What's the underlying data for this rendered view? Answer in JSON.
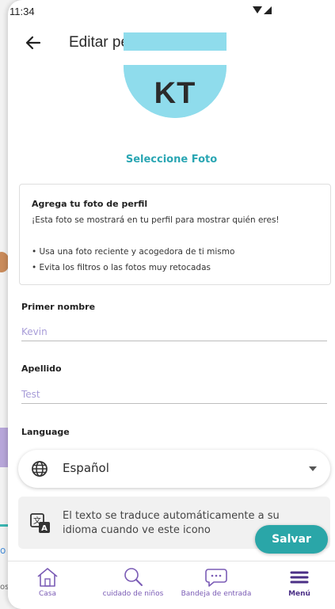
{
  "status_bar": {
    "time": "11:34"
  },
  "header": {
    "title": "Editar perfil"
  },
  "avatar": {
    "initials": "KT"
  },
  "select_photo_label": "Seleccione Foto",
  "info_card": {
    "title": "Agrega tu foto de perfil",
    "description": "¡Esta foto se mostrará en tu perfil para mostrar quién eres!",
    "bullets": [
      "• Usa una foto reciente y acogedora de ti mismo",
      "• Evita los filtros o las fotos muy retocadas"
    ]
  },
  "form": {
    "first_name": {
      "label": "Primer nombre",
      "value": "Kevin"
    },
    "last_name": {
      "label": "Apellido",
      "value": "Test"
    },
    "language": {
      "label": "Language",
      "value": "Español"
    }
  },
  "translate_note": "El texto se traduce automáticamente a su idioma cuando ve este icono",
  "save_label": "Salvar",
  "bottom_nav": [
    {
      "label": "Casa",
      "icon": "home-icon"
    },
    {
      "label": "cuidado de niños",
      "icon": "search-icon"
    },
    {
      "label": "Bandeja de entrada",
      "icon": "chat-icon"
    },
    {
      "label": "Menú",
      "icon": "menu-icon",
      "active": true
    }
  ],
  "background_app": {
    "fragment_text_1": "o",
    "fragment_text_2": "os"
  },
  "colors": {
    "accent": "#2aa6a8",
    "avatar_bg": "#8fdcec",
    "nav_accent": "#7a5bb5"
  }
}
